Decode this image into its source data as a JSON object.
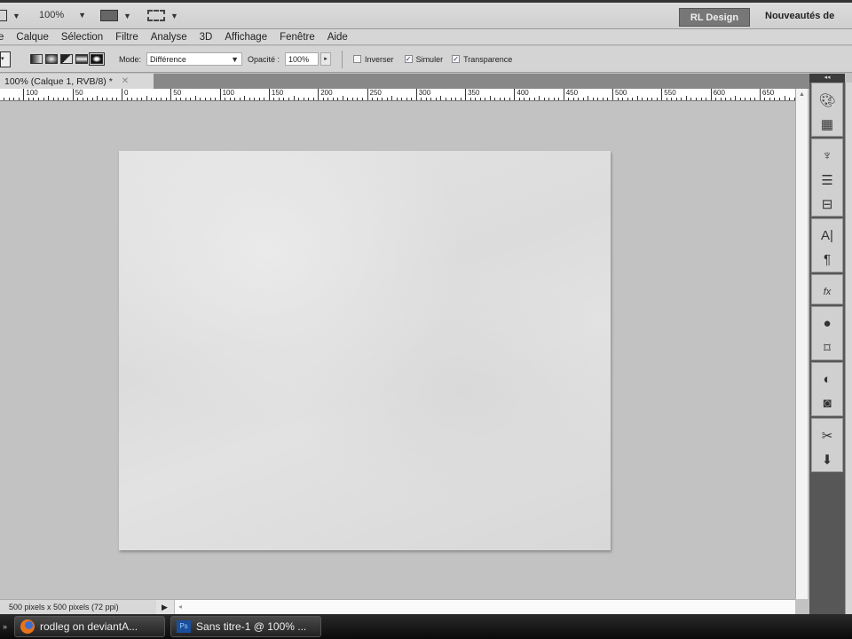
{
  "appbar": {
    "zoom": "100%",
    "workspace_button": "RL Design",
    "whats_new": "Nouveautés de"
  },
  "menu": [
    "e",
    "Calque",
    "Sélection",
    "Filtre",
    "Analyse",
    "3D",
    "Affichage",
    "Fenêtre",
    "Aide"
  ],
  "options": {
    "mode_label": "Mode:",
    "mode_value": "Différence",
    "opacity_label": "Opacité :",
    "opacity_value": "100%",
    "inverser": "Inverser",
    "simuler": "Simuler",
    "transparence": "Transparence",
    "inverser_checked": false,
    "simuler_checked": true,
    "transparence_checked": true
  },
  "tab": {
    "title": "100% (Calque 1, RVB/8) *"
  },
  "ruler": [
    "100",
    "50",
    "0",
    "50",
    "100",
    "150",
    "200",
    "250",
    "300",
    "350",
    "400",
    "450",
    "500",
    "550",
    "600",
    "650"
  ],
  "dock": {
    "collapse": "◂◂",
    "icons": [
      "palette-icon",
      "swatches-icon",
      "clone-source-icon",
      "adjustments-icon",
      "layer-comps-icon",
      "character-icon",
      "paragraph-icon",
      "styles-icon",
      "3d-icon",
      "mask-icon",
      "channels-icon",
      "paths-icon",
      "tools-preset-icon",
      "stamp-icon"
    ]
  },
  "status": {
    "doc_size": "500 pixels x 500 pixels (72 ppi)"
  },
  "taskbar": {
    "items": [
      "rodleg on deviantA...",
      "Sans titre-1 @ 100% ..."
    ],
    "ps_label": "Ps"
  }
}
